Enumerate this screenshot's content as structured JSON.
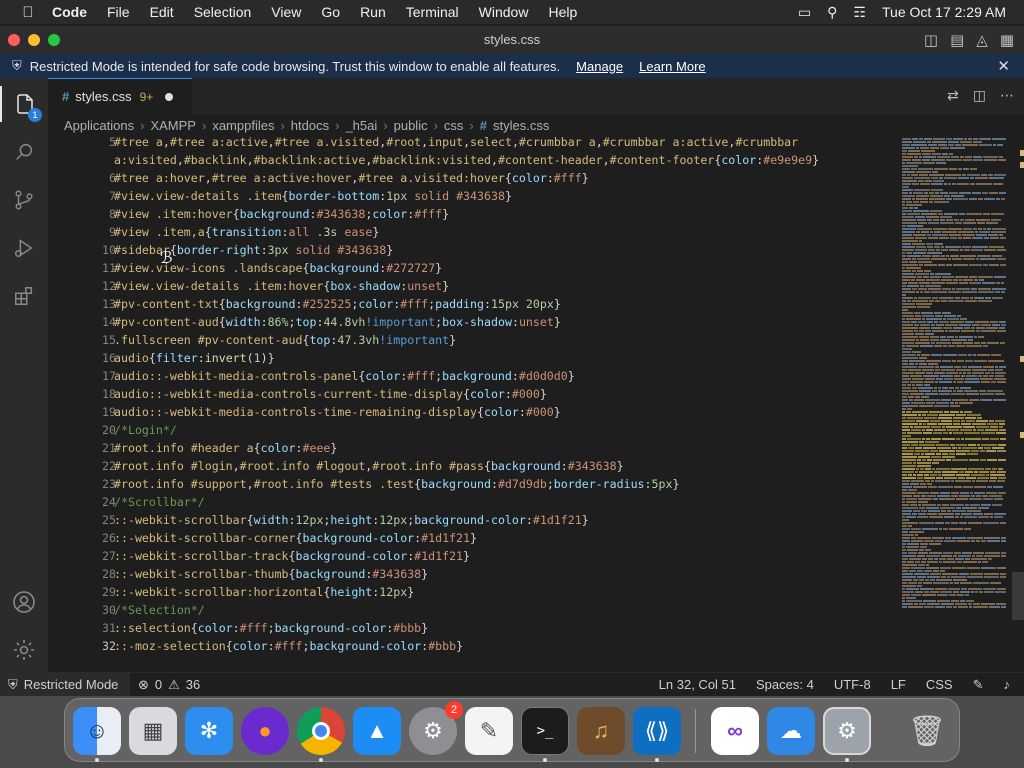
{
  "menubar": {
    "app": "Code",
    "menus": [
      "File",
      "Edit",
      "Selection",
      "View",
      "Go",
      "Run",
      "Terminal",
      "Window",
      "Help"
    ],
    "clock": "Tue Oct 17  2:29 AM"
  },
  "window": {
    "title": "styles.css"
  },
  "banner": {
    "text": "Restricted Mode is intended for safe code browsing. Trust this window to enable all features.",
    "manage": "Manage",
    "learn_more": "Learn More"
  },
  "activity": {
    "explorer_badge": "1"
  },
  "tab": {
    "name": "styles.css",
    "problems": "9+"
  },
  "breadcrumb": [
    "Applications",
    "XAMPP",
    "xamppfiles",
    "htdocs",
    "_h5ai",
    "public",
    "css",
    "styles.css"
  ],
  "editor": {
    "current_line": 32,
    "lines": [
      {
        "n": "5",
        "html": "<span class='sel'>#tree a</span><span class='punc'>,</span><span class='sel'>#tree a:active</span><span class='punc'>,</span><span class='sel'>#tree a.visited</span><span class='punc'>,</span><span class='sel'>#root</span><span class='punc'>,</span><span class='sel'>input</span><span class='punc'>,</span><span class='sel'>select</span><span class='punc'>,</span><span class='sel'>#crumbbar a</span><span class='punc'>,</span><span class='sel'>#crumbbar a:active</span><span class='punc'>,</span><span class='sel'>#crumbbar</span>"
      },
      {
        "n": "",
        "html": "<span class='sel'>a:visited</span><span class='punc'>,</span><span class='sel'>#backlink</span><span class='punc'>,</span><span class='sel'>#backlink:active</span><span class='punc'>,</span><span class='sel'>#backlink:visited</span><span class='punc'>,</span><span class='sel'>#content-header</span><span class='punc'>,</span><span class='sel'>#content-footer</span><span class='punc'>{</span><span class='prop'>color</span><span class='punc'>:</span><span class='val'>#e9e9e9</span><span class='punc'>}</span>"
      },
      {
        "n": "6",
        "html": "<span class='sel'>#tree a:hover</span><span class='punc'>,</span><span class='sel'>#tree a:active:hover</span><span class='punc'>,</span><span class='sel'>#tree a.visited:hover</span><span class='punc'>{</span><span class='prop'>color</span><span class='punc'>:</span><span class='val'>#fff</span><span class='punc'>}</span>"
      },
      {
        "n": "7",
        "html": "<span class='sel'>#view.view-details .item</span><span class='punc'>{</span><span class='prop'>border-bottom</span><span class='punc'>:</span><span class='num'>1px</span> <span class='val'>solid #343638</span><span class='punc'>}</span>"
      },
      {
        "n": "8",
        "html": "<span class='sel'>#view .item:hover</span><span class='punc'>{</span><span class='prop'>background</span><span class='punc'>:</span><span class='val'>#343638</span><span class='punc'>;</span><span class='prop'>color</span><span class='punc'>:</span><span class='val'>#fff</span><span class='punc'>}</span>"
      },
      {
        "n": "9",
        "html": "<span class='sel'>#view .item,a</span><span class='punc'>{</span><span class='prop'>transition</span><span class='punc'>:</span><span class='val'>all</span> <span class='num'>.3s</span> <span class='val'>ease</span><span class='punc'>}</span>"
      },
      {
        "n": "10",
        "html": "<span class='sel'>#sidebar</span><span class='punc'>{</span><span class='prop'>border-right</span><span class='punc'>:</span><span class='num'>3px</span> <span class='val'>solid #343638</span><span class='punc'>}</span>"
      },
      {
        "n": "11",
        "html": "<span class='sel'>#view.view-icons .landscape</span><span class='punc'>{</span><span class='prop'>background</span><span class='punc'>:</span><span class='val'>#272727</span><span class='punc'>}</span>"
      },
      {
        "n": "12",
        "html": "<span class='sel'>#view.view-details .item:hover</span><span class='punc'>{</span><span class='prop'>box-shadow</span><span class='punc'>:</span><span class='val'>unset</span><span class='punc'>}</span>"
      },
      {
        "n": "13",
        "html": "<span class='sel'>#pv-content-txt</span><span class='punc'>{</span><span class='prop'>background</span><span class='punc'>:</span><span class='val'>#252525</span><span class='punc'>;</span><span class='prop'>color</span><span class='punc'>:</span><span class='val'>#fff</span><span class='punc'>;</span><span class='prop'>padding</span><span class='punc'>:</span><span class='num'>15px 20px</span><span class='punc'>}</span>"
      },
      {
        "n": "14",
        "html": "<span class='sel'>#pv-content-aud</span><span class='punc'>{</span><span class='prop'>width</span><span class='punc'>:</span><span class='num'>86%</span><span class='punc'>;</span><span class='prop'>top</span><span class='punc'>:</span><span class='num'>44.8vh</span><span class='kw'>!important</span><span class='punc'>;</span><span class='prop'>box-shadow</span><span class='punc'>:</span><span class='val'>unset</span><span class='punc'>}</span>"
      },
      {
        "n": "15",
        "html": "<span class='sel'>.fullscreen #pv-content-aud</span><span class='punc'>{</span><span class='prop'>top</span><span class='punc'>:</span><span class='num'>47.3vh</span><span class='kw'>!important</span><span class='punc'>}</span>"
      },
      {
        "n": "16",
        "html": "<span class='sel'>audio</span><span class='punc'>{</span><span class='prop'>filter</span><span class='punc'>:</span><span class='fn'>invert</span><span class='punc'>(</span><span class='num'>1</span><span class='punc'>)}</span>"
      },
      {
        "n": "17",
        "html": "<span class='sel'>audio::-webkit-media-controls-panel</span><span class='punc'>{</span><span class='prop'>color</span><span class='punc'>:</span><span class='val'>#fff</span><span class='punc'>;</span><span class='prop'>background</span><span class='punc'>:</span><span class='val'>#d0d0d0</span><span class='punc'>}</span>"
      },
      {
        "n": "18",
        "html": "<span class='sel'>audio::-webkit-media-controls-current-time-display</span><span class='punc'>{</span><span class='prop'>color</span><span class='punc'>:</span><span class='val'>#000</span><span class='punc'>}</span>"
      },
      {
        "n": "19",
        "html": "<span class='sel'>audio::-webkit-media-controls-time-remaining-display</span><span class='punc'>{</span><span class='prop'>color</span><span class='punc'>:</span><span class='val'>#000</span><span class='punc'>}</span>"
      },
      {
        "n": "20",
        "html": "<span class='com'>/*Login*/</span>"
      },
      {
        "n": "21",
        "html": "<span class='sel'>#root.info #header a</span><span class='punc'>{</span><span class='prop'>color</span><span class='punc'>:</span><span class='val'>#eee</span><span class='punc'>}</span>"
      },
      {
        "n": "22",
        "html": "<span class='sel'>#root.info #login</span><span class='punc'>,</span><span class='sel'>#root.info #logout</span><span class='punc'>,</span><span class='sel'>#root.info #pass</span><span class='punc'>{</span><span class='prop'>background</span><span class='punc'>:</span><span class='val'>#343638</span><span class='punc'>}</span>"
      },
      {
        "n": "23",
        "html": "<span class='sel'>#root.info #support</span><span class='punc'>,</span><span class='sel'>#root.info #tests .test</span><span class='punc'>{</span><span class='prop'>background</span><span class='punc'>:</span><span class='val'>#d7d9db</span><span class='punc'>;</span><span class='prop'>border-radius</span><span class='punc'>:</span><span class='num'>5px</span><span class='punc'>}</span>"
      },
      {
        "n": "24",
        "html": "<span class='com'>/*Scrollbar*/</span>"
      },
      {
        "n": "25",
        "html": "<span class='sel'>::-webkit-scrollbar</span><span class='punc'>{</span><span class='prop'>width</span><span class='punc'>:</span><span class='num'>12px</span><span class='punc'>;</span><span class='prop'>height</span><span class='punc'>:</span><span class='num'>12px</span><span class='punc'>;</span><span class='prop'>background-color</span><span class='punc'>:</span><span class='val'>#1d1f21</span><span class='punc'>}</span>"
      },
      {
        "n": "26",
        "html": "<span class='sel'>::-webkit-scrollbar-corner</span><span class='punc'>{</span><span class='prop'>background-color</span><span class='punc'>:</span><span class='val'>#1d1f21</span><span class='punc'>}</span>"
      },
      {
        "n": "27",
        "html": "<span class='sel'>::-webkit-scrollbar-track</span><span class='punc'>{</span><span class='prop'>background-color</span><span class='punc'>:</span><span class='val'>#1d1f21</span><span class='punc'>}</span>"
      },
      {
        "n": "28",
        "html": "<span class='sel'>::-webkit-scrollbar-thumb</span><span class='punc'>{</span><span class='prop'>background</span><span class='punc'>:</span><span class='val'>#343638</span><span class='punc'>}</span>"
      },
      {
        "n": "29",
        "html": "<span class='sel'>::-webkit-scrollbar:horizontal</span><span class='punc'>{</span><span class='prop'>height</span><span class='punc'>:</span><span class='num'>12px</span><span class='punc'>}</span>"
      },
      {
        "n": "30",
        "html": "<span class='com'>/*Selection*/</span>"
      },
      {
        "n": "31",
        "html": "<span class='sel'>::selection</span><span class='punc'>{</span><span class='prop'>color</span><span class='punc'>:</span><span class='val'>#fff</span><span class='punc'>;</span><span class='prop'>background-color</span><span class='punc'>:</span><span class='val'>#bbb</span><span class='punc'>}</span>"
      },
      {
        "n": "32",
        "html": "<span class='sel'>::-moz-selection</span><span class='punc'>{</span><span class='prop'>color</span><span class='punc'>:</span><span class='val'>#fff</span><span class='punc'>;</span><span class='prop'>background-color</span><span class='punc'>:</span><span class='val'>#bbb</span><span class='punc'>}</span>"
      }
    ]
  },
  "statusbar": {
    "restricted": "Restricted Mode",
    "errors": "0",
    "warnings": "36",
    "position": "Ln 32, Col 51",
    "spaces": "Spaces: 4",
    "encoding": "UTF-8",
    "eol": "LF",
    "language": "CSS"
  },
  "dock": {
    "settings_badge": "2",
    "items": [
      "Finder",
      "Launchpad",
      "Safari",
      "Firefox",
      "Chrome",
      "App Store",
      "System Settings",
      "TextEdit",
      "Terminal",
      "Instruments",
      "Visual Studio Code",
      "Visual Studio",
      "Weather",
      "System Preferences",
      "Trash"
    ]
  },
  "colors": {
    "accent": "#3a8ee6",
    "banner_bg": "#1b2e4a",
    "editor_bg": "#1e1e1e",
    "css_hash": "#519aba"
  }
}
